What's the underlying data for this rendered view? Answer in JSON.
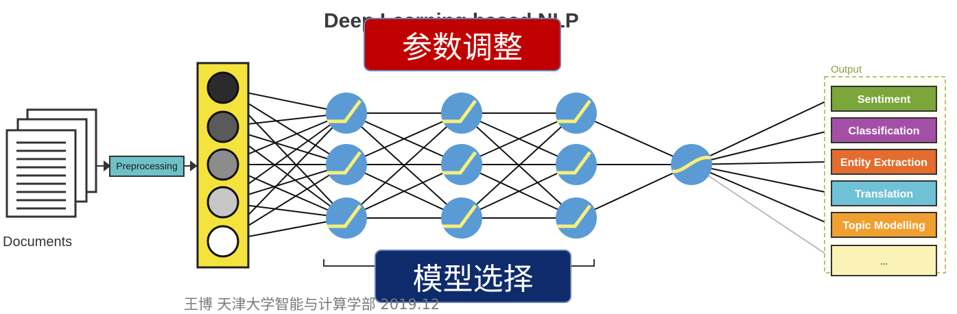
{
  "diagram": {
    "title": "Deep Learning based NLP",
    "documents_label": "Documents",
    "preprocessing_label": "Preprocessing",
    "output_label": "Output",
    "outputs": [
      {
        "label": "Sentiment",
        "color": "#7aa63a"
      },
      {
        "label": "Classification",
        "color": "#a44fa6"
      },
      {
        "label": "Entity Extraction",
        "color": "#e36c2e"
      },
      {
        "label": "Translation",
        "color": "#6fc1d6"
      },
      {
        "label": "Topic Modelling",
        "color": "#f0a030"
      },
      {
        "label": "...",
        "color": "#fbf2b7"
      }
    ],
    "input_node_colors": [
      "#2b2b2b",
      "#5a5a5a",
      "#8c8c8c",
      "#c6c6c6",
      "#ffffff"
    ],
    "neuron_color": "#5b9bd5",
    "activation_color": "#f6ef7a",
    "input_column_color": "#f5e33d"
  },
  "overlay": {
    "top_label": "参数调整",
    "bottom_label": "模型选择"
  },
  "footer": "王博 天津大学智能与计算学部 2019.12"
}
